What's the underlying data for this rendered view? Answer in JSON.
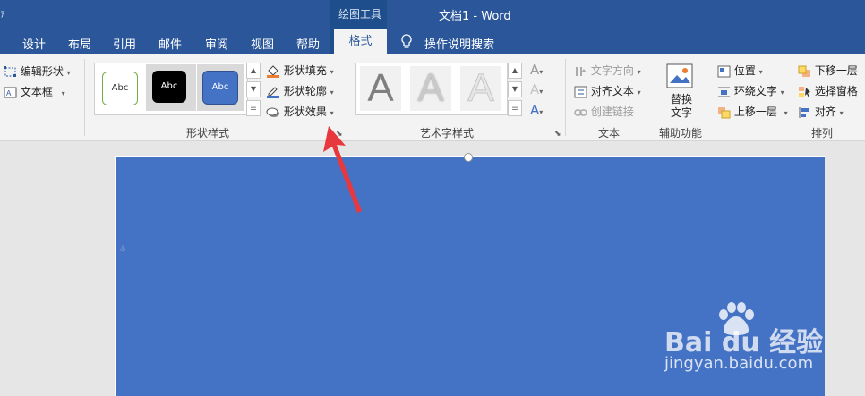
{
  "title_bar": {
    "context_tool": "绘图工具",
    "doc_title": "文档1  -  Word"
  },
  "tabs": [
    "设计",
    "布局",
    "引用",
    "邮件",
    "审阅",
    "视图",
    "帮助"
  ],
  "active_tab": "格式",
  "tell_me": "操作说明搜索",
  "ribbon": {
    "insert_shapes": {
      "edit_shape": "编辑形状",
      "text_box": "文本框"
    },
    "shape_styles": {
      "label": "形状样式",
      "swatches": [
        "Abc",
        "Abc",
        "Abc"
      ],
      "fill": "形状填充",
      "outline": "形状轮廓",
      "effects": "形状效果"
    },
    "wordart": {
      "label": "艺术字样式",
      "letters": [
        "A",
        "A",
        "A"
      ]
    },
    "text": {
      "label": "文本",
      "direction": "文字方向",
      "align": "对齐文本",
      "link": "创建链接"
    },
    "accessibility": {
      "label": "辅助功能",
      "alt_text": "替换\n文字"
    },
    "arrange": {
      "label": "排列",
      "position": "位置",
      "wrap": "环绕文字",
      "forward": "上移一层",
      "backward": "下移一层",
      "selection": "选择窗格",
      "align": "对齐"
    }
  },
  "watermark": {
    "brand": "Bai du 经验",
    "url": "jingyan.baidu.com"
  },
  "colors": {
    "title_blue": "#2b579a",
    "shape_fill": "#4472c4",
    "arrow_red": "#e8383d"
  }
}
